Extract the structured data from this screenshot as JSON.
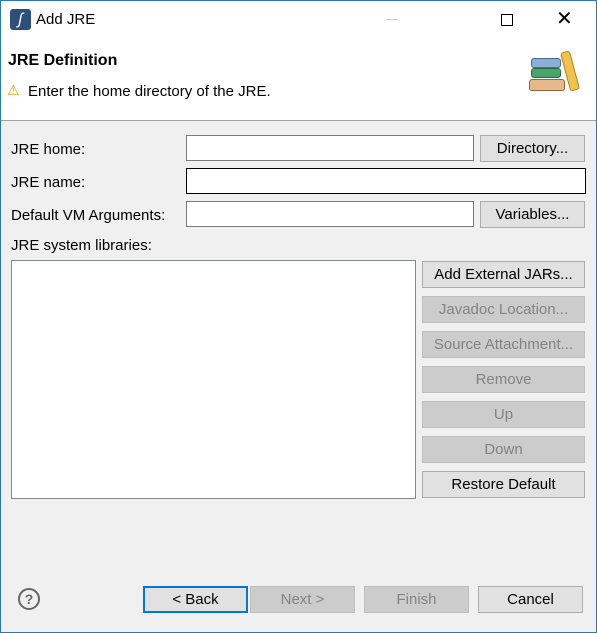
{
  "window": {
    "title": "Add JRE"
  },
  "header": {
    "title": "JRE Definition",
    "message": "Enter the home directory of the JRE."
  },
  "form": {
    "jre_home_label": "JRE home:",
    "jre_home_value": "",
    "directory_button": "Directory...",
    "jre_name_label": "JRE name:",
    "jre_name_value": "",
    "vm_args_label": "Default VM Arguments:",
    "vm_args_value": "",
    "variables_button": "Variables...",
    "libraries_label": "JRE system libraries:"
  },
  "library_buttons": [
    {
      "label": "Add External JARs...",
      "enabled": true
    },
    {
      "label": "Javadoc Location...",
      "enabled": false
    },
    {
      "label": "Source Attachment...",
      "enabled": false
    },
    {
      "label": "Remove",
      "enabled": false
    },
    {
      "label": "Up",
      "enabled": false
    },
    {
      "label": "Down",
      "enabled": false
    },
    {
      "label": "Restore Default",
      "enabled": true
    }
  ],
  "footer": {
    "back": "< Back",
    "next": "Next >",
    "finish": "Finish",
    "cancel": "Cancel"
  },
  "colors": {
    "accent": "#0078d7",
    "warning": "#f5b400"
  }
}
